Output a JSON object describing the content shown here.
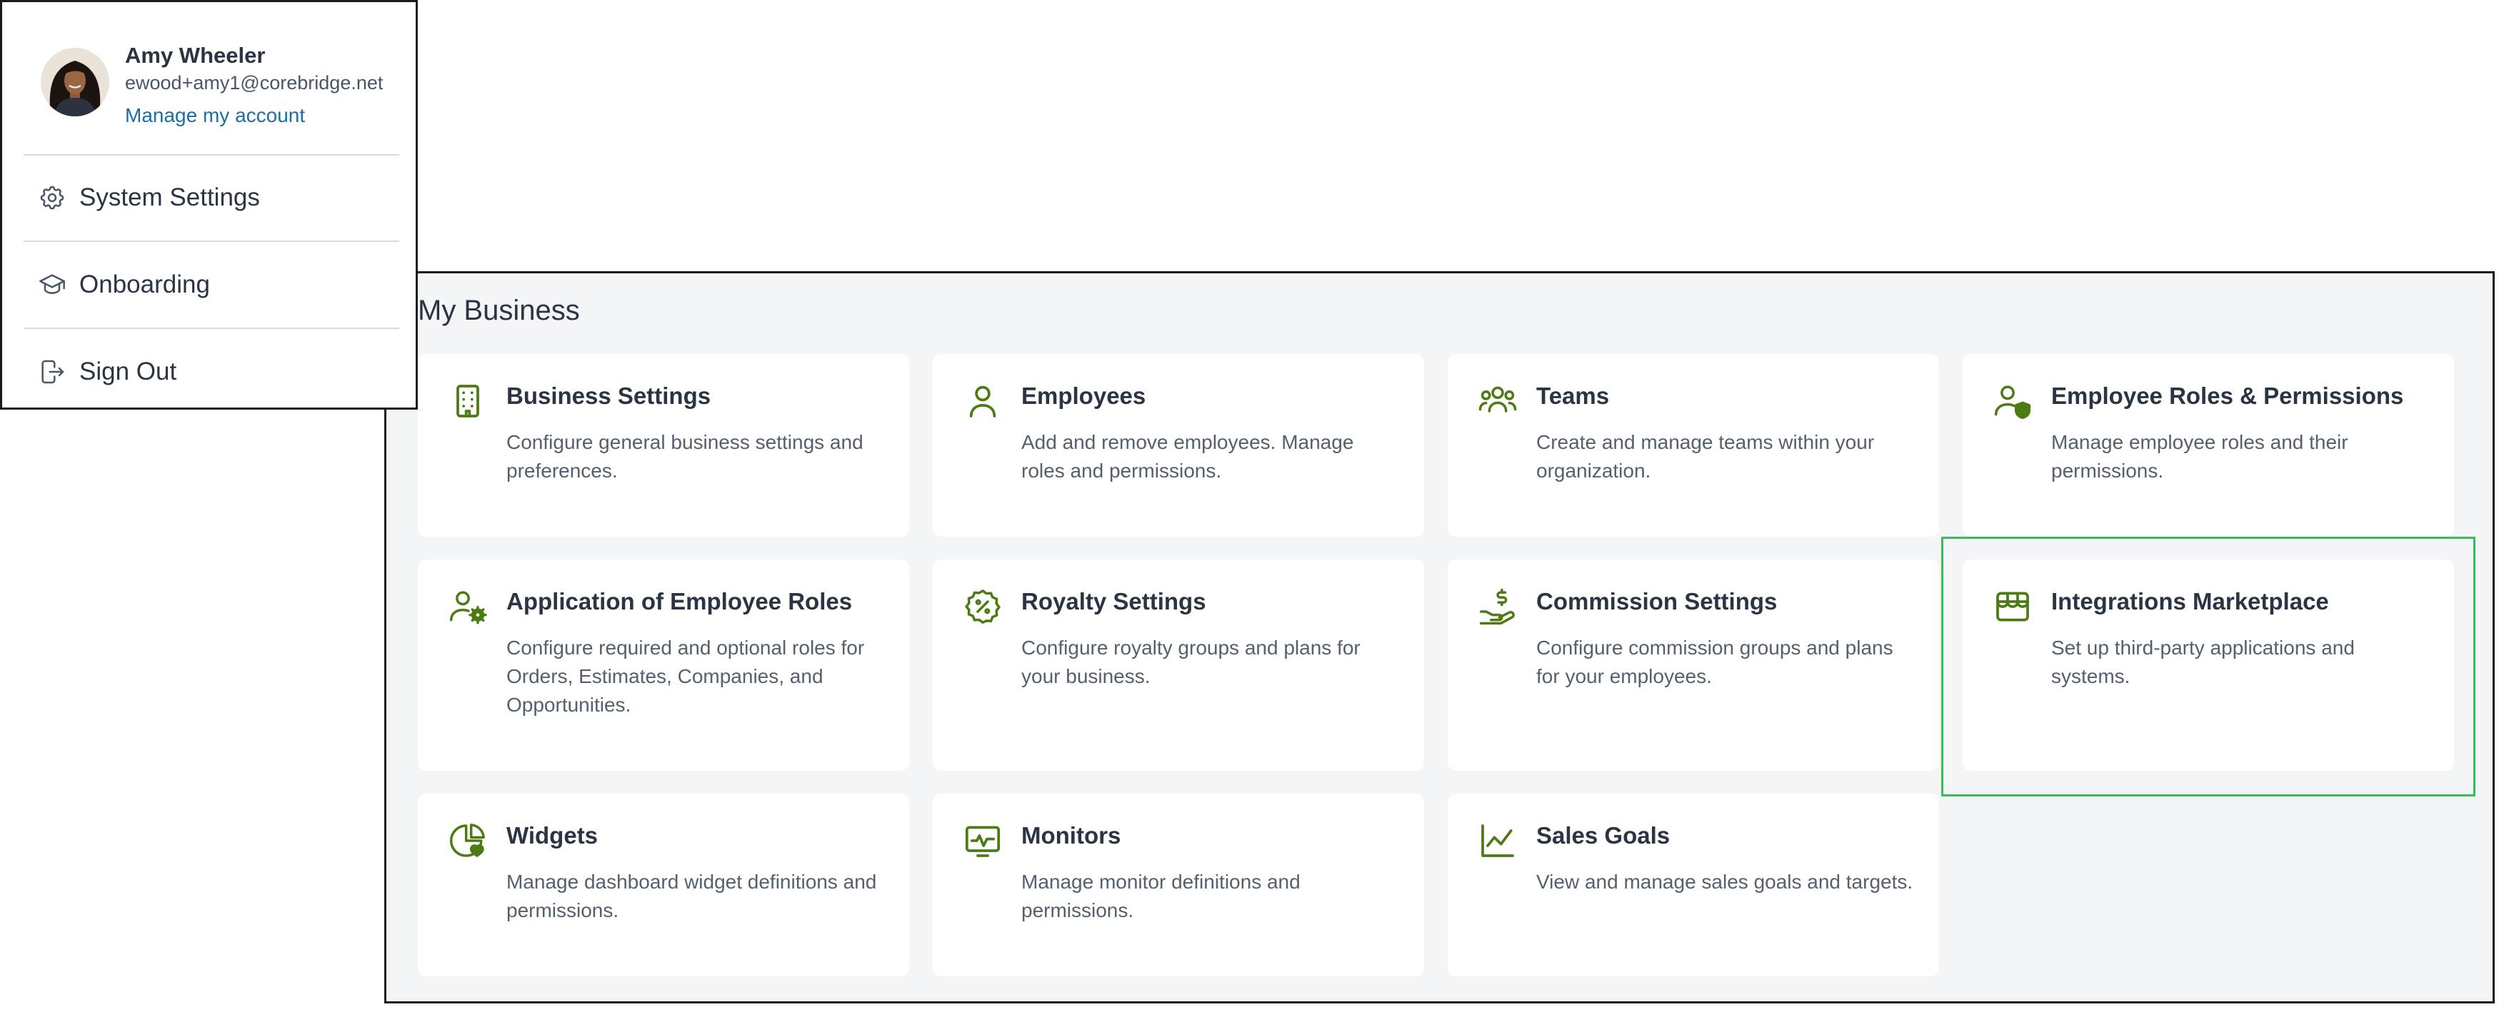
{
  "account_menu": {
    "user_name": "Amy Wheeler",
    "user_email": "ewood+amy1@corebridge.net",
    "manage_link": "Manage my account",
    "items": [
      {
        "label": "System Settings",
        "icon": "gear-icon"
      },
      {
        "label": "Onboarding",
        "icon": "graduation-cap-icon"
      },
      {
        "label": "Sign Out",
        "icon": "sign-out-icon"
      }
    ]
  },
  "my_business": {
    "title": "My Business",
    "icon_color": "#4d7a12",
    "cards": [
      {
        "title": "Business Settings",
        "description": "Configure general business settings and preferences.",
        "icon": "building-icon"
      },
      {
        "title": "Employees",
        "description": "Add and remove employees. Manage roles and permissions.",
        "icon": "user-icon"
      },
      {
        "title": "Teams",
        "description": "Create and manage teams within your organization.",
        "icon": "users-icon"
      },
      {
        "title": "Employee Roles & Permissions",
        "description": "Manage employee roles and their permissions.",
        "icon": "user-shield-icon"
      },
      {
        "title": "Application of Employee Roles",
        "description": "Configure required and optional roles for Orders, Estimates, Companies, and Opportunities.",
        "icon": "user-gear-icon"
      },
      {
        "title": "Royalty Settings",
        "description": "Configure royalty groups and plans for your business.",
        "icon": "percent-badge-icon"
      },
      {
        "title": "Commission Settings",
        "description": "Configure commission groups and plans for your employees.",
        "icon": "hand-dollar-icon"
      },
      {
        "title": "Integrations Marketplace",
        "description": "Set up third-party applications and systems.",
        "icon": "store-icon"
      },
      {
        "title": "Widgets",
        "description": "Manage dashboard widget definitions and permissions.",
        "icon": "pie-chart-icon"
      },
      {
        "title": "Monitors",
        "description": "Manage monitor definitions and permissions.",
        "icon": "monitor-pulse-icon"
      },
      {
        "title": "Sales Goals",
        "description": "View and manage sales goals and targets.",
        "icon": "line-chart-icon"
      }
    ]
  }
}
